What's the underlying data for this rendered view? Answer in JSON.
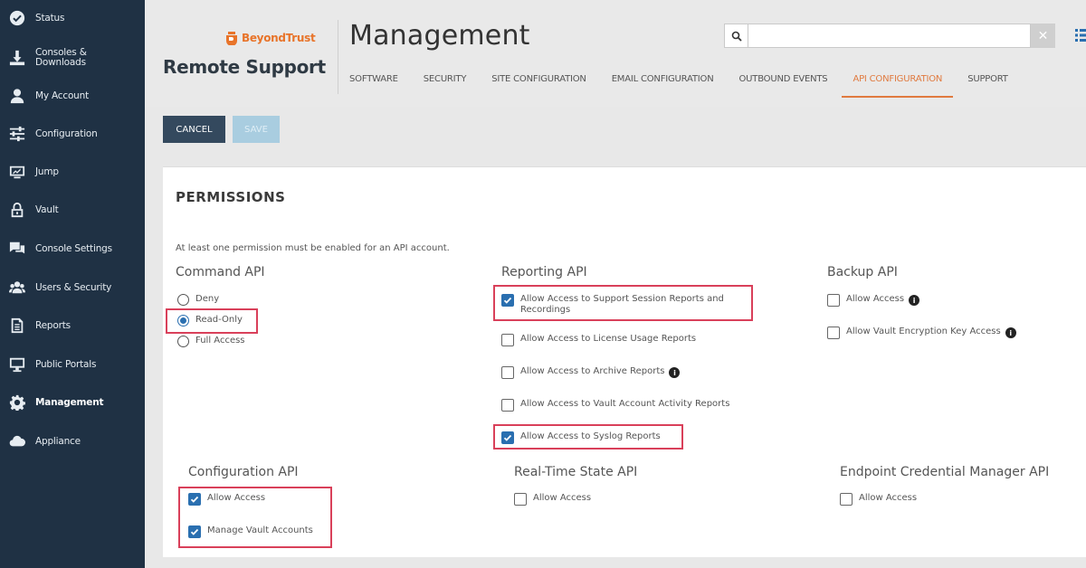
{
  "sidebar": {
    "items": [
      {
        "label": "Status",
        "icon": "status-icon"
      },
      {
        "label": "Consoles & Downloads",
        "icon": "download-icon"
      },
      {
        "label": "My Account",
        "icon": "user-icon"
      },
      {
        "label": "Configuration",
        "icon": "sliders-icon"
      },
      {
        "label": "Jump",
        "icon": "jump-icon"
      },
      {
        "label": "Vault",
        "icon": "lock-icon"
      },
      {
        "label": "Console Settings",
        "icon": "chat-icon"
      },
      {
        "label": "Users & Security",
        "icon": "users-icon"
      },
      {
        "label": "Reports",
        "icon": "document-icon"
      },
      {
        "label": "Public Portals",
        "icon": "monitor-icon"
      },
      {
        "label": "Management",
        "icon": "gear-icon",
        "active": true
      },
      {
        "label": "Appliance",
        "icon": "cloud-icon"
      }
    ]
  },
  "header": {
    "brand": "BeyondTrust",
    "product": "Remote Support",
    "title": "Management",
    "search": {
      "value": "",
      "placeholder": ""
    },
    "tabs": [
      {
        "label": "SOFTWARE"
      },
      {
        "label": "SECURITY"
      },
      {
        "label": "SITE CONFIGURATION"
      },
      {
        "label": "EMAIL CONFIGURATION"
      },
      {
        "label": "OUTBOUND EVENTS"
      },
      {
        "label": "API CONFIGURATION",
        "active": true
      },
      {
        "label": "SUPPORT"
      }
    ]
  },
  "actions": {
    "cancel": "CANCEL",
    "save": "SAVE"
  },
  "permissions": {
    "title": "PERMISSIONS",
    "note": "At least one permission must be enabled for an API account.",
    "command_api": {
      "title": "Command API",
      "options": [
        "Deny",
        "Read-Only",
        "Full Access"
      ],
      "selected": "Read-Only"
    },
    "reporting_api": {
      "title": "Reporting API",
      "options": [
        {
          "label": "Allow Access to Support Session Reports and Recordings",
          "checked": true
        },
        {
          "label": "Allow Access to License Usage Reports",
          "checked": false
        },
        {
          "label": "Allow Access to Archive Reports",
          "checked": false
        },
        {
          "label": "Allow Access to Vault Account Activity Reports",
          "checked": false
        },
        {
          "label": "Allow Access to Syslog Reports",
          "checked": true
        }
      ]
    },
    "backup_api": {
      "title": "Backup API",
      "options": [
        {
          "label": "Allow Access",
          "checked": false
        },
        {
          "label": "Allow Vault Encryption Key Access",
          "checked": false
        }
      ]
    },
    "configuration_api": {
      "title": "Configuration API",
      "options": [
        {
          "label": "Allow Access",
          "checked": true
        },
        {
          "label": "Manage Vault Accounts",
          "checked": true
        }
      ]
    },
    "realtime_api": {
      "title": "Real-Time State API",
      "options": [
        {
          "label": "Allow Access",
          "checked": false
        }
      ]
    },
    "ecm_api": {
      "title": "Endpoint Credential Manager API",
      "options": [
        {
          "label": "Allow Access",
          "checked": false
        }
      ]
    }
  },
  "colors": {
    "sidebar_bg": "#1f3144",
    "accent": "#e07a3f",
    "highlight": "#d9405a",
    "checkbox": "#2a6fb0",
    "cancel_bg": "#34495e",
    "save_bg": "#a9cde0"
  }
}
